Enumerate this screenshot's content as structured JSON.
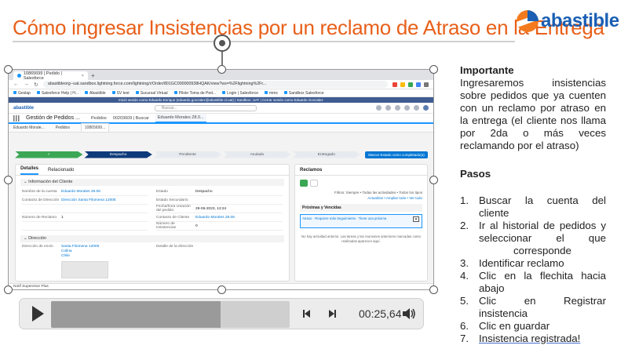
{
  "slide": {
    "title": "Cómo ingresar Insistencias por un reclamo de Atraso en la Entrega",
    "brand": "abastible",
    "accent_color": "#e8601a",
    "brand_color": "#1a5fb4"
  },
  "screen": {
    "browser_tab": "10865699 | Pedido | Salesforce",
    "url": "abastibleorg--uat.sandbox.lightning.force.com/lightning/r/Order/801GC000000938HQAK/view?ws=%2Flightning%2Fr...",
    "bookmarks": [
      "Geslap",
      "Salesforce Help | H...",
      "Abastible",
      "SV test",
      "Sucursal Virtual",
      "Piloto Toma de Ped...",
      "Login | Salesforce",
      "mms",
      "Sandbox Salesforce"
    ],
    "sandbox_notice": "Inició sesión como Eduardo Enrique (eduardo.gonzalez@abastible.cl.uat) | Sandbox: UAT | Cerrar sesión como Eduardo Gonzalez",
    "app_logo": "abastible",
    "search_placeholder": "Buscar...",
    "app_name": "Gestión de Pedidos ...",
    "nav_items": [
      "Pedidos",
      "00203609 | Buscar",
      "Eduardo Morales 28.0..."
    ],
    "sub_tabs": [
      "Eduardo Morale...",
      "Pedidos",
      "10865699..."
    ],
    "path_steps": [
      "✓",
      "Despacho",
      "Pendiente",
      "Anulado",
      "Entregado"
    ],
    "path_button": "Marcar Estado como completado(a)",
    "detail_tabs": [
      "Detalles",
      "Relacionado"
    ],
    "section_client": "Información del Cliente",
    "fields": [
      {
        "label": "Nombre de la cuenta",
        "value": "Eduardo Morales 28.06",
        "link": true
      },
      {
        "label": "Estado",
        "value": "Despacho",
        "link": false
      },
      {
        "label": "Contacto de Dirección",
        "value": "Dirección Santa Filomena 12005",
        "link": true
      },
      {
        "label": "Estado Secundario",
        "value": "",
        "link": false
      },
      {
        "label": "Fecha/hora creación del pedido",
        "value": "29-06-2023, 13:24",
        "link": false
      },
      {
        "label": "Número de Reclamo",
        "value": "1",
        "link": false
      },
      {
        "label": "Contacto de Cliente",
        "value": "Eduardo Morales 28.06",
        "link": true
      },
      {
        "label": "Número de Insistencias",
        "value": "0",
        "link": false
      }
    ],
    "section_address": "Dirección",
    "address_label": "Dirección de envío",
    "address_lines": [
      "Santa Filomena 12005",
      "Colina",
      "Chile"
    ],
    "detail_address_label": "Detalle de la dirección",
    "reclamos_title": "Reclamos",
    "reclamos_filter": "Filtros: Siempre • Todas las actividades • Todos los tipos",
    "reclamos_links": "Actualizar • Ampliar todo • Ver todo",
    "upcoming_label": "Próximas y Vencidas",
    "reclamo_item": "Atraso  ·  Requiere más Seguimiento  ·  Tiene una próxima",
    "reclamo_note": "No hay actividad anterior. Las tareas y las reuniones anteriores marcadas como realizadas aparecen aquí.",
    "footer_bar": "Notif Supervisor Plus"
  },
  "player": {
    "time": "00:25,64",
    "progress": 0.71
  },
  "panel": {
    "importante_title": "Importante",
    "importante_text": "Ingresaremos insistencias sobre pedidos que ya cuenten con un reclamo por atraso en la entrega (el cliente nos llama por 2da o más veces reclamando por el atraso)",
    "pasos_title": "Pasos",
    "steps": [
      "Buscar la cuenta del cliente",
      "Ir al historial de pedidos y seleccionar el que",
      "corresponde",
      "Identificar reclamo",
      "Clic en la flechita hacia abajo",
      "Clic en Registrar insistencia",
      "Clic en guardar",
      "Insistencia registrada!"
    ]
  }
}
